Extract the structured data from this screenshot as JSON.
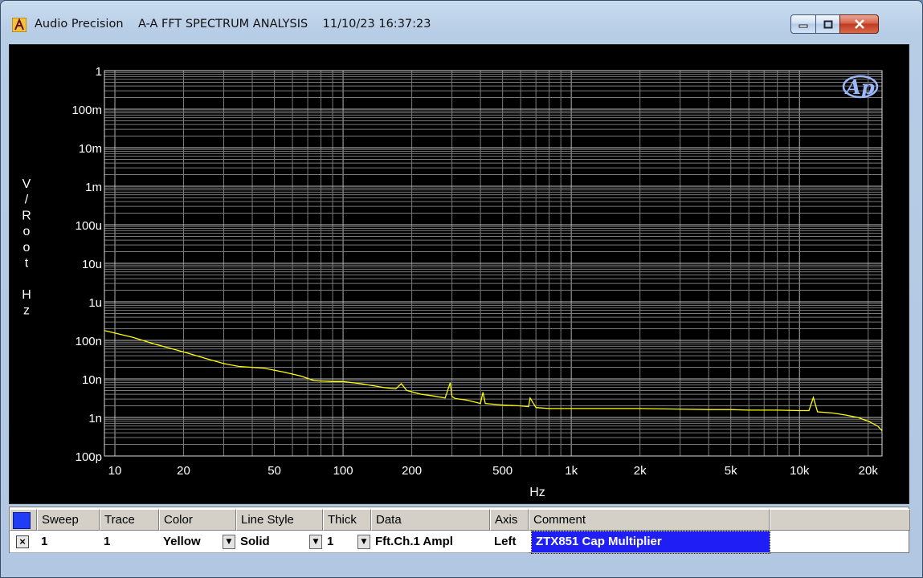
{
  "window": {
    "app_name": "Audio Precision",
    "title": "A-A FFT SPECTRUM ANALYSIS",
    "timestamp": "11/10/23 16:37:23",
    "buttons": {
      "minimize": "minimize-icon",
      "maximize": "maximize-icon",
      "close": "close-icon"
    }
  },
  "logo_text": "Ap",
  "chart_data": {
    "type": "line",
    "title": "",
    "xlabel": "Hz",
    "ylabel": "V / Root Hz",
    "ylabel_chars": [
      "V",
      "/",
      "R",
      "o",
      "o",
      "t",
      "",
      "H",
      "z"
    ],
    "x_scale": "log",
    "y_scale": "log",
    "xlim": [
      9,
      23000
    ],
    "ylim": [
      1e-10,
      1
    ],
    "x_ticks": [
      {
        "value": 10,
        "label": "10"
      },
      {
        "value": 20,
        "label": "20"
      },
      {
        "value": 50,
        "label": "50"
      },
      {
        "value": 100,
        "label": "100"
      },
      {
        "value": 200,
        "label": "200"
      },
      {
        "value": 500,
        "label": "500"
      },
      {
        "value": 1000,
        "label": "1k"
      },
      {
        "value": 2000,
        "label": "2k"
      },
      {
        "value": 5000,
        "label": "5k"
      },
      {
        "value": 10000,
        "label": "10k"
      },
      {
        "value": 20000,
        "label": "20k"
      }
    ],
    "y_ticks": [
      {
        "value": 1,
        "label": "1"
      },
      {
        "value": 0.1,
        "label": "100m"
      },
      {
        "value": 0.01,
        "label": "10m"
      },
      {
        "value": 0.001,
        "label": "1m"
      },
      {
        "value": 0.0001,
        "label": "100u"
      },
      {
        "value": 1e-05,
        "label": "10u"
      },
      {
        "value": 1e-06,
        "label": "1u"
      },
      {
        "value": 1e-07,
        "label": "100n"
      },
      {
        "value": 1e-08,
        "label": "10n"
      },
      {
        "value": 1e-09,
        "label": "1n"
      },
      {
        "value": 1e-10,
        "label": "100p"
      }
    ],
    "grid": true,
    "background": "#000000",
    "grid_color": "#7a7a7a",
    "series": [
      {
        "color": "#ffff00",
        "x": [
          9,
          12,
          15,
          20,
          25,
          30,
          35,
          45,
          55,
          65,
          75,
          90,
          100,
          120,
          150,
          170,
          180,
          190,
          220,
          250,
          280,
          295,
          300,
          310,
          350,
          400,
          410,
          420,
          500,
          600,
          650,
          660,
          700,
          800,
          1000,
          1500,
          2000,
          3000,
          4000,
          5000,
          6000,
          8000,
          10000,
          11000,
          11500,
          12000,
          14000,
          16000,
          18000,
          20000,
          22000,
          23000
        ],
        "y": [
          1.8e-07,
          1.2e-07,
          8e-08,
          5e-08,
          3.4e-08,
          2.5e-08,
          2.1e-08,
          1.9e-08,
          1.5e-08,
          1.2e-08,
          9e-09,
          8.5e-09,
          8.5e-09,
          7.5e-09,
          6e-09,
          5.5e-09,
          7.5e-09,
          5e-09,
          4e-09,
          3.6e-09,
          3.2e-09,
          8e-09,
          3.5e-09,
          3.1e-09,
          2.8e-09,
          2.3e-09,
          4.5e-09,
          2.3e-09,
          2.1e-09,
          2e-09,
          1.9e-09,
          3.2e-09,
          1.8e-09,
          1.7e-09,
          1.7e-09,
          1.7e-09,
          1.7e-09,
          1.65e-09,
          1.6e-09,
          1.6e-09,
          1.55e-09,
          1.55e-09,
          1.5e-09,
          1.5e-09,
          3.3e-09,
          1.4e-09,
          1.3e-09,
          1.15e-09,
          1e-09,
          8e-10,
          6e-10,
          4.5e-10
        ]
      }
    ]
  },
  "table": {
    "headers": [
      "Sweep",
      "Trace",
      "Color",
      "Line Style",
      "Thick",
      "Data",
      "Axis",
      "Comment"
    ],
    "row": {
      "checked": "×",
      "sweep": "1",
      "trace": "1",
      "color": "Yellow",
      "line_style": "Solid",
      "thick": "1",
      "data": "Fft.Ch.1 Ampl",
      "axis": "Left",
      "comment": "ZTX851 Cap Multiplier"
    },
    "swatch_color": "#1f3df5",
    "selection_color": "#1f1ff5"
  }
}
